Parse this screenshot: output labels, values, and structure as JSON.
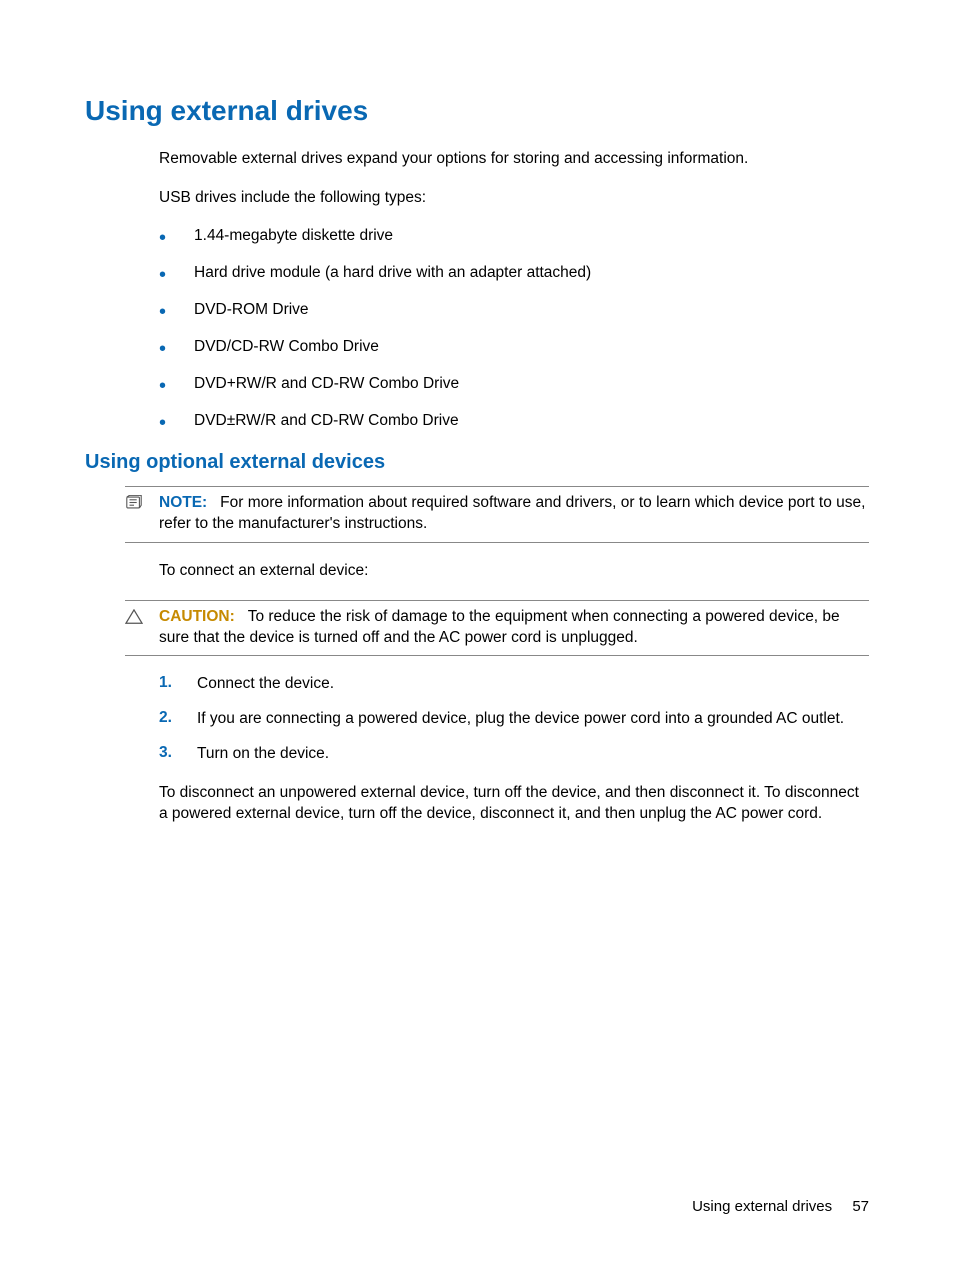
{
  "heading1": "Using external drives",
  "intro1": "Removable external drives expand your options for storing and accessing information.",
  "intro2": "USB drives include the following types:",
  "bullets": [
    "1.44-megabyte diskette drive",
    "Hard drive module (a hard drive with an adapter attached)",
    "DVD-ROM Drive",
    "DVD/CD-RW Combo Drive",
    "DVD+RW/R and CD-RW Combo Drive",
    "DVD±RW/R and CD-RW Combo Drive"
  ],
  "heading2": "Using optional external devices",
  "note": {
    "label": "NOTE:",
    "text": "For more information about required software and drivers, or to learn which device port to use, refer to the manufacturer's instructions."
  },
  "connect_text": "To connect an external device:",
  "caution": {
    "label": "CAUTION:",
    "text": "To reduce the risk of damage to the equipment when connecting a powered device, be sure that the device is turned off and the AC power cord is unplugged."
  },
  "steps": [
    "Connect the device.",
    "If you are connecting a powered device, plug the device power cord into a grounded AC outlet.",
    "Turn on the device."
  ],
  "step_numbers": [
    "1.",
    "2.",
    "3."
  ],
  "disconnect_text": "To disconnect an unpowered external device, turn off the device, and then disconnect it. To disconnect a powered external device, turn off the device, disconnect it, and then unplug the AC power cord.",
  "footer": {
    "title": "Using external drives",
    "page": "57"
  }
}
